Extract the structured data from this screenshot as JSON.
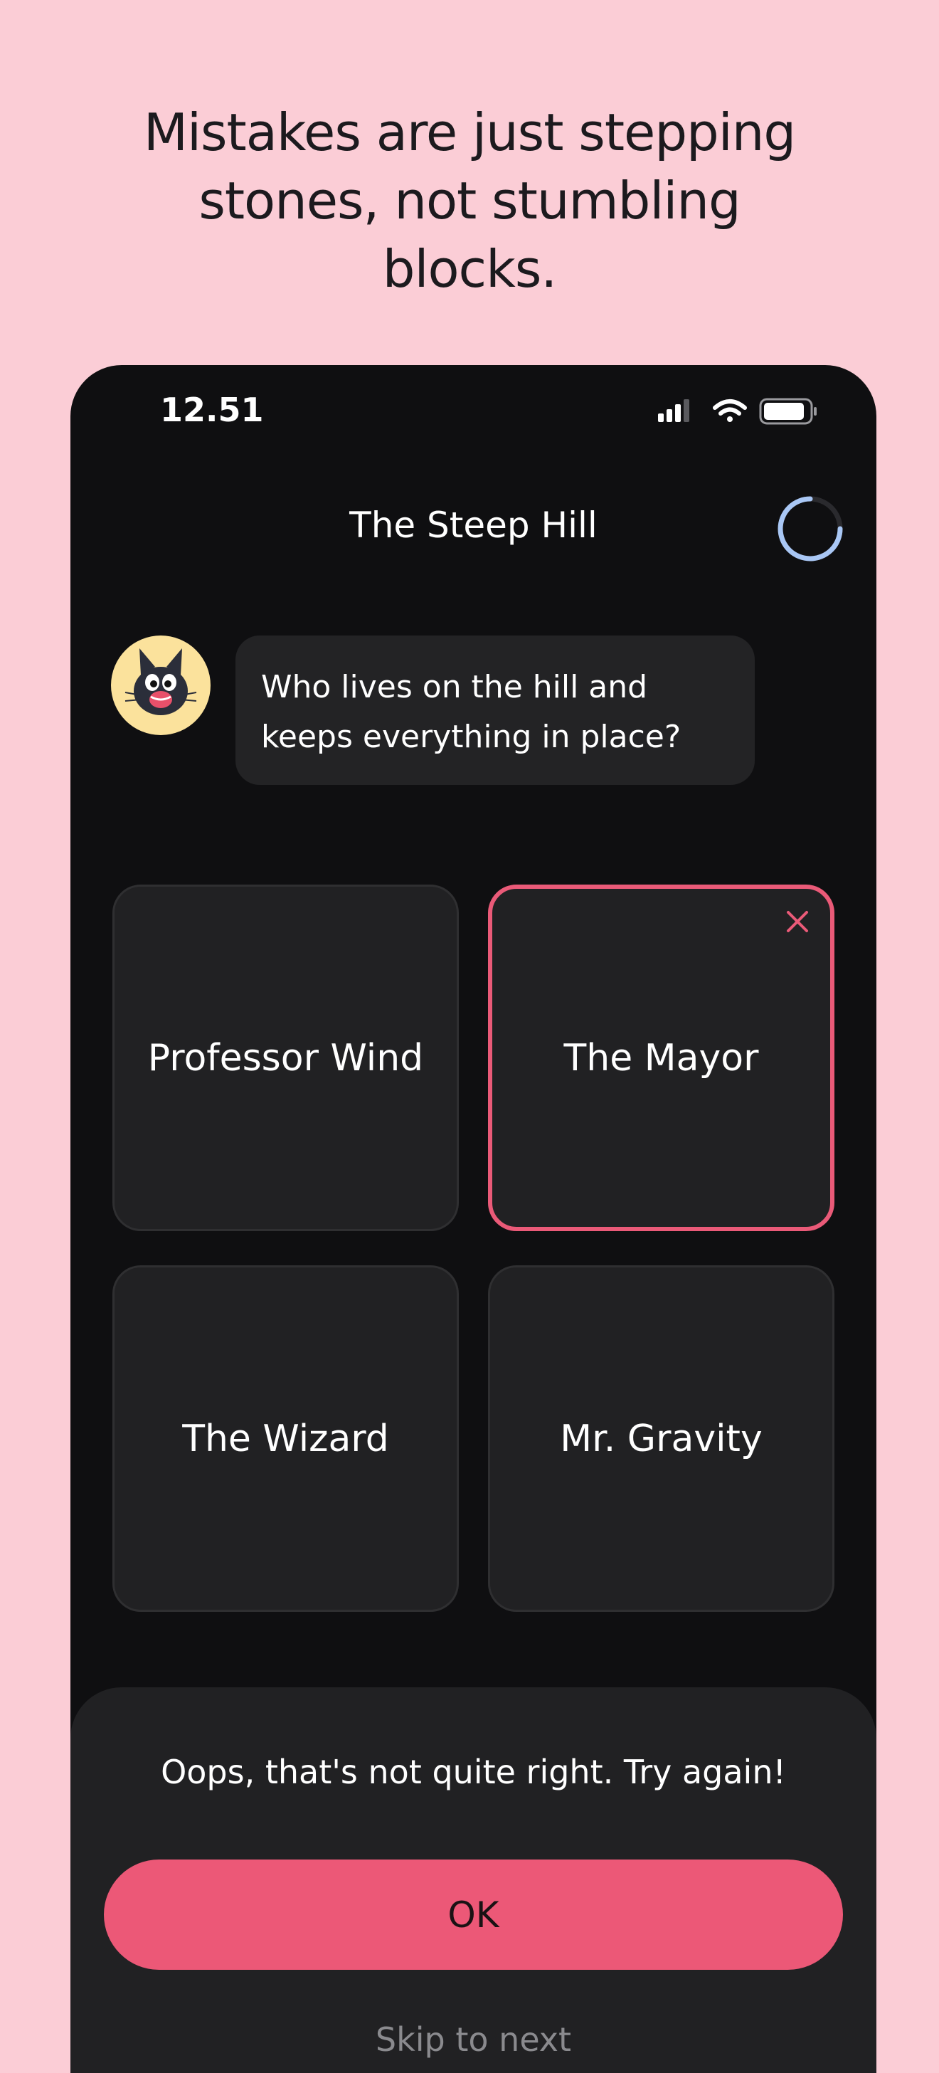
{
  "headline": "Mistakes are just stepping stones, not stumbling blocks.",
  "status_bar": {
    "time": "12.51",
    "icons": [
      "signal-icon",
      "wifi-icon",
      "battery-icon"
    ]
  },
  "lesson": {
    "title": "The Steep Hill",
    "progress_icon": "progress-spinner-icon"
  },
  "question": {
    "avatar_icon": "black-cat-avatar",
    "text": "Who lives on the hill and keeps everything in place?"
  },
  "answers": [
    {
      "label": "Professor Wind",
      "state": "default"
    },
    {
      "label": "The Mayor",
      "state": "wrong"
    },
    {
      "label": "The Wizard",
      "state": "default"
    },
    {
      "label": "Mr. Gravity",
      "state": "default"
    }
  ],
  "feedback": {
    "message": "Oops, that's not quite right. Try again!",
    "ok_label": "OK",
    "skip_label": "Skip to next"
  },
  "colors": {
    "page_background": "#fbcdd6",
    "app_background": "#0f0f11",
    "card_background": "#212123",
    "accent": "#ec5877",
    "spinner": "#a9c7f5",
    "avatar_background": "#fbe29c"
  }
}
